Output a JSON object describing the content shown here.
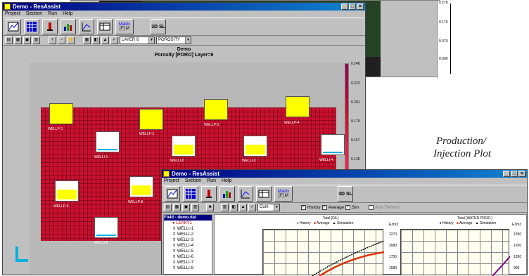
{
  "background_window": {
    "legend_ticks": [
      "0.278",
      "0.170",
      "0.070",
      "0.000"
    ]
  },
  "window1": {
    "title": "Demo - ResAssist",
    "menu": [
      "Project",
      "Section",
      "Run",
      "Help"
    ],
    "toolbar_big": [
      "map-button",
      "grid-button",
      "well-button",
      "chart-button",
      "table-button",
      "view-button",
      "matrix-button"
    ],
    "matrix_label": "Matrix",
    "sl_label": "3D SL",
    "layer_select": "LAYER 6",
    "property_select": "POROSITY",
    "plot_title_1": "Demo",
    "plot_title_2": "Porosity [PORO]  Layer=6",
    "legend_ticks": [
      "0.248",
      "0.223",
      "0.201",
      "0.179",
      "0.157",
      "0.135"
    ],
    "wells": [
      "WELLP-1",
      "WELLP-2",
      "WELLP-3",
      "WELLP-4",
      "WELLI-1",
      "WELLI-2",
      "WELLI-3",
      "WELLI-4",
      "WELLP-6",
      "WELLP-8",
      "WELLI-5"
    ]
  },
  "caption": {
    "line1": "Production/",
    "line2": "Injection Plot"
  },
  "window2": {
    "title": "Demo - ResAssist",
    "menu": [
      "Project",
      "Section",
      "Run",
      "Help"
    ],
    "matrix_label": "Matrix",
    "sl_label": "3D SL",
    "cum_select": "Cum",
    "history_label": "History",
    "average_label": "Average",
    "sim_label": "Sim",
    "extra_label": "Auto Refresh",
    "tree": [
      "Field - demo.dat",
      "LEAKY1",
      "WELLI-1",
      "WELLI-2",
      "WELLI-3",
      "WELLI-4",
      "WELLI-5",
      "WELLI-6",
      "WELLI-7",
      "WELLI-8"
    ],
    "chart1_title": "Total [OIL]",
    "chart2_title": "Total [WATER PROD.]",
    "legend_history": "History",
    "legend_average": "Average",
    "legend_simulation": "Simulation",
    "unit": "E3m3",
    "chart1_ticks": [
      "2270",
      "2080",
      "1750",
      "1580"
    ],
    "chart2_ticks": [
      "1350",
      "1200",
      "1050",
      "900"
    ]
  },
  "colors": {
    "titlebar": "#000080",
    "porosity": "#c8102e",
    "history": "#00a000",
    "average": "#e03000",
    "simulation": "#000000",
    "arrow": "#00b0e0"
  }
}
